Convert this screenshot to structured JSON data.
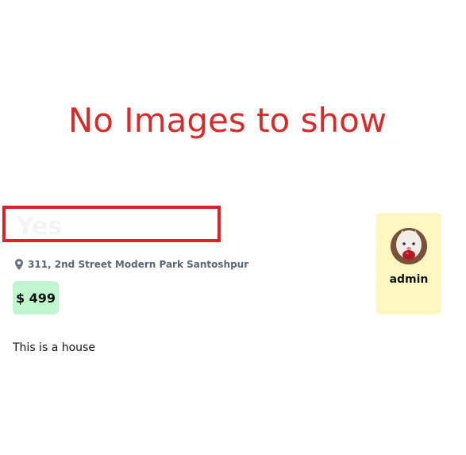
{
  "gallery": {
    "empty_message": "No Images to show"
  },
  "listing": {
    "title": "Yes",
    "address": "311, 2nd Street Modern Park Santoshpur",
    "price": "$ 499",
    "description": "This is a house",
    "location_icon": "map-pin-icon"
  },
  "owner": {
    "name": "admin",
    "avatar_icon": "cat-avatar"
  },
  "colors": {
    "empty_message": "#d62b2b",
    "title_border": "#e12026",
    "price_badge": "#bff5cf",
    "owner_card": "#fff7c2",
    "muted_text": "#5d6570"
  }
}
